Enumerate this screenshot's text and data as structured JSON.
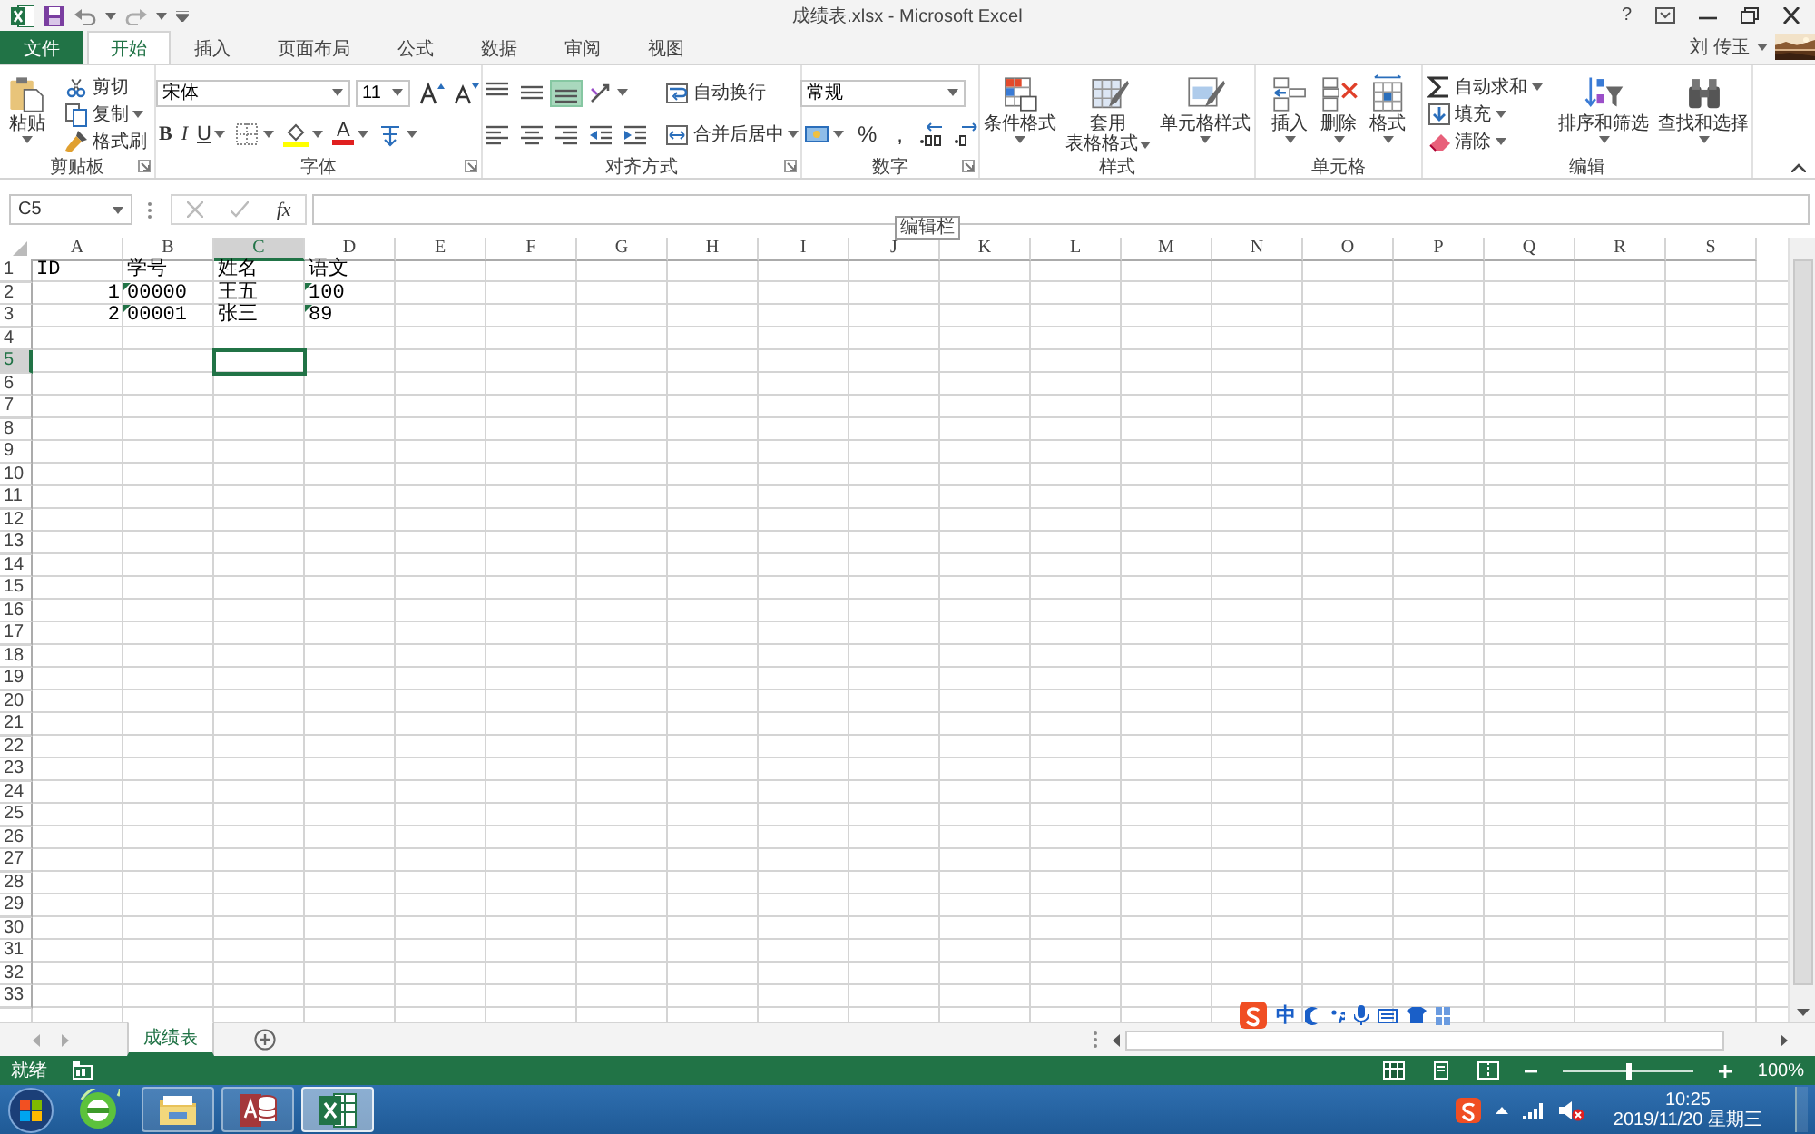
{
  "window": {
    "title": "成绩表.xlsx - Microsoft Excel",
    "help": "?"
  },
  "user": {
    "name": "刘 传玉"
  },
  "tabs": [
    {
      "label": "文件",
      "kind": "file",
      "selected": false
    },
    {
      "label": "开始",
      "kind": "tab",
      "selected": true
    },
    {
      "label": "插入",
      "kind": "tab",
      "selected": false
    },
    {
      "label": "页面布局",
      "kind": "tab",
      "selected": false
    },
    {
      "label": "公式",
      "kind": "tab",
      "selected": false
    },
    {
      "label": "数据",
      "kind": "tab",
      "selected": false
    },
    {
      "label": "审阅",
      "kind": "tab",
      "selected": false
    },
    {
      "label": "视图",
      "kind": "tab",
      "selected": false
    }
  ],
  "ribbon": {
    "groups": [
      {
        "label": "剪贴板",
        "launcher": true,
        "columns": [
          [
            [
              {
                "kind": "large",
                "label": "粘贴",
                "dropdown": true
              }
            ]
          ],
          [
            [
              {
                "kind": "button",
                "label": "剪切",
                "dropdown": false
              }
            ],
            [
              {
                "kind": "button",
                "label": "复制",
                "dropdown": true
              }
            ],
            [
              {
                "kind": "button",
                "label": "格式刷",
                "dropdown": false
              }
            ]
          ]
        ]
      },
      {
        "label": "字体",
        "launcher": true,
        "columns": [
          [
            [
              {
                "kind": "fontbox",
                "value": "宋体"
              },
              {
                "kind": "sizebox",
                "value": "11"
              },
              {
                "kind": "icon",
                "selected": false,
                "dropdown": false
              },
              {
                "kind": "icon",
                "selected": false,
                "dropdown": false
              }
            ],
            [
              {
                "kind": "bold",
                "label": "B",
                "dropdown": false
              },
              {
                "kind": "italic",
                "label": "I",
                "dropdown": false
              },
              {
                "kind": "underline",
                "label": "U",
                "dropdown": true
              },
              {
                "kind": "icon",
                "selected": false,
                "dropdown": true
              },
              {
                "kind": "icon",
                "selected": false,
                "dropdown": true
              },
              {
                "kind": "fontcolor",
                "label": "A",
                "dropdown": true
              },
              {
                "kind": "icon",
                "selected": false,
                "dropdown": true
              }
            ]
          ]
        ]
      },
      {
        "label": "对齐方式",
        "launcher": true,
        "columns": [
          [
            [
              {
                "kind": "icon",
                "selected": false,
                "dropdown": false
              },
              {
                "kind": "icon",
                "selected": false,
                "dropdown": false
              },
              {
                "kind": "icon",
                "selected": true,
                "dropdown": false
              },
              {
                "kind": "icon",
                "selected": false,
                "dropdown": true
              }
            ],
            [
              {
                "kind": "icon",
                "selected": false,
                "dropdown": false
              },
              {
                "kind": "icon",
                "selected": false,
                "dropdown": false
              },
              {
                "kind": "icon",
                "selected": false,
                "dropdown": false
              },
              {
                "kind": "icon",
                "selected": false,
                "dropdown": false
              },
              {
                "kind": "icon",
                "selected": false,
                "dropdown": false
              }
            ]
          ],
          [
            [
              {
                "kind": "button",
                "label": "自动换行",
                "dropdown": false
              }
            ],
            [
              {
                "kind": "button",
                "label": "合并后居中",
                "dropdown": true
              }
            ]
          ]
        ]
      },
      {
        "label": "数字",
        "launcher": true,
        "columns": [
          [
            [
              {
                "kind": "formatbox",
                "value": "常规"
              }
            ],
            [
              {
                "kind": "icon",
                "selected": false,
                "dropdown": true
              },
              {
                "kind": "text",
                "label": "%",
                "dropdown": false
              },
              {
                "kind": "text",
                "label": ",",
                "dropdown": false
              },
              {
                "kind": "icon",
                "selected": false,
                "dropdown": false
              },
              {
                "kind": "icon",
                "selected": false,
                "dropdown": false
              }
            ]
          ]
        ]
      },
      {
        "label": "样式",
        "launcher": false,
        "columns": [
          [
            [
              {
                "kind": "large",
                "label": "条件格式",
                "dropdown": true
              },
              {
                "kind": "large",
                "lines": [
                  "套用",
                  "表格格式"
                ],
                "dropdown": true
              },
              {
                "kind": "large",
                "label": "单元格样式",
                "dropdown": true
              }
            ]
          ]
        ]
      },
      {
        "label": "单元格",
        "launcher": false,
        "columns": [
          [
            [
              {
                "kind": "large",
                "label": "插入",
                "dropdown": true
              },
              {
                "kind": "large",
                "label": "删除",
                "dropdown": true
              },
              {
                "kind": "large",
                "label": "格式",
                "dropdown": true
              }
            ]
          ]
        ]
      },
      {
        "label": "编辑",
        "launcher": false,
        "columns": [
          [
            [
              {
                "kind": "button",
                "label": "自动求和",
                "dropdown": true
              }
            ],
            [
              {
                "kind": "button",
                "label": "填充",
                "dropdown": true
              }
            ],
            [
              {
                "kind": "button",
                "label": "清除",
                "dropdown": true
              }
            ]
          ],
          [
            [
              {
                "kind": "large",
                "label": "排序和筛选",
                "dropdown": true
              },
              {
                "kind": "large",
                "label": "查找和选择",
                "dropdown": true
              }
            ]
          ]
        ]
      }
    ]
  },
  "formula_bar": {
    "name_box": "C5",
    "function_label": "fx",
    "tooltip": "编辑栏"
  },
  "grid": {
    "columns": [
      {
        "label": "A",
        "selected": false
      },
      {
        "label": "B",
        "selected": false
      },
      {
        "label": "C",
        "selected": true
      },
      {
        "label": "D",
        "selected": false
      },
      {
        "label": "E",
        "selected": false
      },
      {
        "label": "F",
        "selected": false
      },
      {
        "label": "G",
        "selected": false
      },
      {
        "label": "H",
        "selected": false
      },
      {
        "label": "I",
        "selected": false
      },
      {
        "label": "J",
        "selected": false
      },
      {
        "label": "K",
        "selected": false
      },
      {
        "label": "L",
        "selected": false
      },
      {
        "label": "M",
        "selected": false
      },
      {
        "label": "N",
        "selected": false
      },
      {
        "label": "O",
        "selected": false
      },
      {
        "label": "P",
        "selected": false
      },
      {
        "label": "Q",
        "selected": false
      },
      {
        "label": "R",
        "selected": false
      },
      {
        "label": "S",
        "selected": false
      }
    ],
    "row_headers": [
      {
        "label": "1",
        "selected": false
      },
      {
        "label": "2",
        "selected": false
      },
      {
        "label": "3",
        "selected": false
      },
      {
        "label": "4",
        "selected": false
      },
      {
        "label": "5",
        "selected": true
      },
      {
        "label": "6",
        "selected": false
      },
      {
        "label": "7",
        "selected": false
      },
      {
        "label": "8",
        "selected": false
      },
      {
        "label": "9",
        "selected": false
      },
      {
        "label": "10",
        "selected": false
      },
      {
        "label": "11",
        "selected": false
      },
      {
        "label": "12",
        "selected": false
      },
      {
        "label": "13",
        "selected": false
      },
      {
        "label": "14",
        "selected": false
      },
      {
        "label": "15",
        "selected": false
      },
      {
        "label": "16",
        "selected": false
      },
      {
        "label": "17",
        "selected": false
      },
      {
        "label": "18",
        "selected": false
      },
      {
        "label": "19",
        "selected": false
      },
      {
        "label": "20",
        "selected": false
      },
      {
        "label": "21",
        "selected": false
      },
      {
        "label": "22",
        "selected": false
      },
      {
        "label": "23",
        "selected": false
      },
      {
        "label": "24",
        "selected": false
      },
      {
        "label": "25",
        "selected": false
      },
      {
        "label": "26",
        "selected": false
      },
      {
        "label": "27",
        "selected": false
      },
      {
        "label": "28",
        "selected": false
      },
      {
        "label": "29",
        "selected": false
      },
      {
        "label": "30",
        "selected": false
      },
      {
        "label": "31",
        "selected": false
      },
      {
        "label": "32",
        "selected": false
      },
      {
        "label": "33",
        "selected": false
      }
    ],
    "rows": [
      {
        "cells": [
          {
            "text": "ID",
            "kind": "text",
            "flag": false
          },
          {
            "text": "学号",
            "kind": "text",
            "flag": false
          },
          {
            "text": "姓名",
            "kind": "text",
            "flag": false
          },
          {
            "text": "语文",
            "kind": "text",
            "flag": false
          }
        ]
      },
      {
        "cells": [
          {
            "text": "1",
            "kind": "number",
            "flag": false
          },
          {
            "text": "00000",
            "kind": "text",
            "flag": true
          },
          {
            "text": "王五",
            "kind": "text",
            "flag": false
          },
          {
            "text": "100",
            "kind": "text",
            "flag": true
          }
        ]
      },
      {
        "cells": [
          {
            "text": "2",
            "kind": "number",
            "flag": false
          },
          {
            "text": "00001",
            "kind": "text",
            "flag": true
          },
          {
            "text": "张三",
            "kind": "text",
            "flag": false
          },
          {
            "text": "89",
            "kind": "text",
            "flag": true
          }
        ]
      }
    ]
  },
  "sheets": [
    {
      "label": "成绩表",
      "selected": true
    }
  ],
  "status_bar": {
    "status": "就绪",
    "zoom_slider": {
      "level": 0.5
    },
    "zoom": "100%"
  },
  "ime_bar": {
    "mode": "中"
  },
  "taskbar": {
    "apps": [
      {
        "kind": "browser",
        "running": false,
        "selected": false
      },
      {
        "kind": "explorer",
        "running": true,
        "selected": false
      },
      {
        "kind": "access",
        "running": true,
        "selected": false
      },
      {
        "kind": "excel",
        "running": true,
        "selected": true
      }
    ],
    "clock": {
      "time": "10:25",
      "date": "2019/11/20 星期三"
    }
  }
}
